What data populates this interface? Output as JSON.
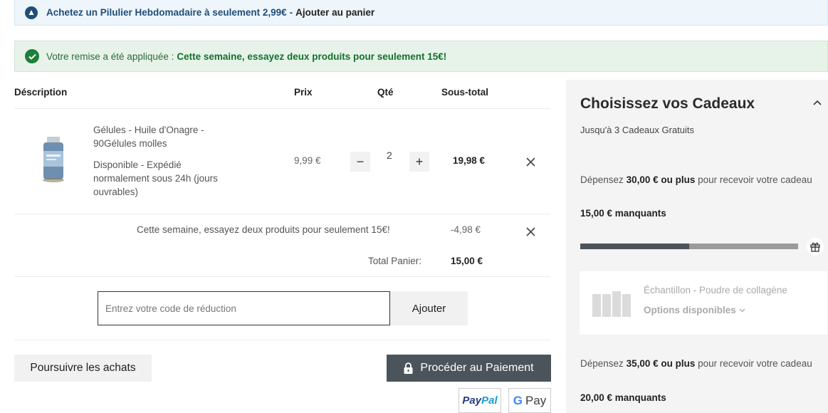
{
  "promo": {
    "link_text": "Achetez un Pilulier Hebdomadaire à seulement 2,99€",
    "separator": "-",
    "cta": "Ajouter au panier"
  },
  "discount_notice": {
    "text": "Votre remise a été appliquée :",
    "strong": "Cette semaine, essayez deux produits pour seulement 15€!"
  },
  "table": {
    "headers": {
      "description": "Déscription",
      "price": "Prix",
      "qty": "Qté",
      "subtotal": "Sous-total"
    }
  },
  "item": {
    "name_line1": "Gélules - Huile d'Onagre -",
    "name_line2": "90Gélules molles",
    "stock_line1": "Disponible - Expédié",
    "stock_line2": "normalement sous 24h (jours",
    "stock_line3": "ouvrables)",
    "price": "9,99 €",
    "qty": "2",
    "minus": "−",
    "plus": "+",
    "subtotal": "19,98 €"
  },
  "discount_row": {
    "label": "Cette semaine, essayez deux produits pour seulement 15€!",
    "amount": "-4,98 €"
  },
  "total": {
    "label": "Total Panier:",
    "value": "15,00 €"
  },
  "coupon": {
    "placeholder": "Entrez votre code de réduction",
    "button": "Ajouter"
  },
  "actions": {
    "continue": "Poursuivre les achats",
    "checkout": "Procéder au Paiement",
    "paypal_a": "Pay",
    "paypal_b": "Pal",
    "gpay_g": "G",
    "gpay_text": "Pay"
  },
  "gifts": {
    "title": "Choisissez vos Cadeaux",
    "subtitle": "Jusqu'à 3 Cadeaux Gratuits",
    "tier1": {
      "pre": "Dépensez",
      "amount": "30,00 € ou plus",
      "post": "pour recevoir votre cadeau",
      "missing": "15,00 € manquants",
      "progress": 0.5
    },
    "gift_item": {
      "name": "Échantillon - Poudre de collagène",
      "options": "Options disponibles"
    },
    "tier2": {
      "pre": "Dépensez",
      "amount": "35,00 € ou plus",
      "post": "pour recevoir votre cadeau",
      "missing": "20,00 € manquants"
    }
  },
  "colors": {
    "promo_blue": "#1f4e79",
    "success_green": "#1e7f3a",
    "checkout_bg": "#4b545b",
    "paypal_dark": "#253b80",
    "paypal_light": "#179bd7"
  }
}
